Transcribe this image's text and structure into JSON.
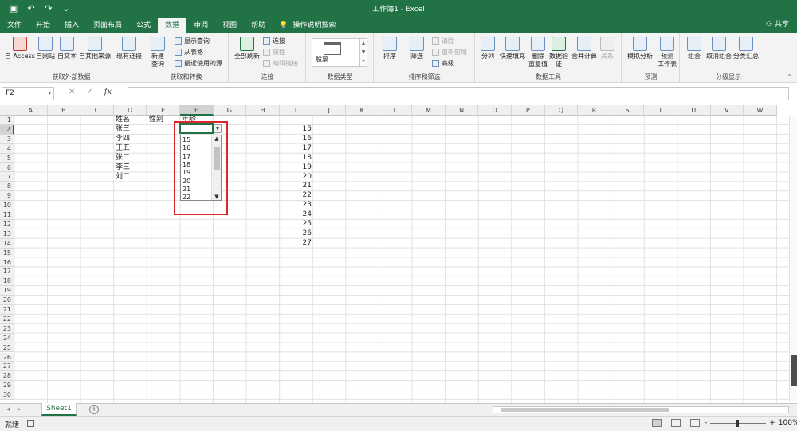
{
  "titlebar": {
    "title": "工作簿1 - Excel",
    "save_icon": "save-icon",
    "undo_icon": "undo-icon",
    "redo_icon": "redo-icon"
  },
  "tabs": [
    "文件",
    "开始",
    "插入",
    "页面布局",
    "公式",
    "数据",
    "审阅",
    "视图",
    "帮助"
  ],
  "active_tab": "数据",
  "tell_me": "操作说明搜索",
  "share": "共享",
  "ribbon": {
    "get_external": {
      "label": "获取外部数据",
      "buttons": [
        "自 Access",
        "自网站",
        "自文本",
        "自其他来源"
      ],
      "existing": "现有连接"
    },
    "get_transform": {
      "label": "获取和转换",
      "new_query": "新建\n查询",
      "items": [
        "显示查询",
        "从表格",
        "最近使用的源"
      ]
    },
    "connections": {
      "label": "连接",
      "refresh_all": "全部刷新",
      "items": [
        "连接",
        "属性",
        "编辑链接"
      ]
    },
    "data_types": {
      "label": "数据类型",
      "stock": "股票"
    },
    "sort_filter": {
      "label": "排序和筛选",
      "sort": "排序",
      "filter": "筛选",
      "items": [
        "清除",
        "重新应用",
        "高级"
      ]
    },
    "data_tools": {
      "label": "数据工具",
      "buttons": [
        "分列",
        "快速填充",
        "删除\n重复值",
        "数据验\n证",
        "合并计算",
        "关系"
      ]
    },
    "forecast": {
      "label": "预测",
      "buttons": [
        "模拟分析",
        "预测\n工作表"
      ]
    },
    "outline": {
      "label": "分级显示",
      "buttons": [
        "组合",
        "取消组合",
        "分类汇总"
      ]
    }
  },
  "formula_bar": {
    "name_box": "F2",
    "fx": "fx",
    "cancel": "✕",
    "enter": "✓",
    "content": ""
  },
  "columns": [
    "A",
    "B",
    "C",
    "D",
    "E",
    "F",
    "G",
    "H",
    "I",
    "J",
    "K",
    "L",
    "M",
    "N",
    "O",
    "P",
    "Q",
    "R",
    "S",
    "T",
    "U",
    "V",
    "W"
  ],
  "rows": [
    "1",
    "2",
    "3",
    "4",
    "5",
    "6",
    "7",
    "8",
    "9",
    "10",
    "11",
    "12",
    "13",
    "14",
    "15",
    "16",
    "17",
    "18",
    "19",
    "20",
    "21",
    "22",
    "23",
    "24",
    "25",
    "26",
    "27",
    "28",
    "29",
    "30"
  ],
  "cells": {
    "D1": "姓名",
    "E1": "性别",
    "F1": "年龄",
    "D2": "张三",
    "D3": "李四",
    "D4": "王五",
    "D5": "张二",
    "D6": "李三",
    "D7": "刘二"
  },
  "column_i_values": [
    "15",
    "16",
    "17",
    "18",
    "19",
    "20",
    "21",
    "22",
    "23",
    "24",
    "25",
    "26",
    "27"
  ],
  "dropdown_options": [
    "15",
    "16",
    "17",
    "18",
    "19",
    "20",
    "21",
    "22"
  ],
  "sheet": {
    "tab": "Sheet1",
    "add": "+"
  },
  "status": {
    "ready": "就绪",
    "zoom": "100%",
    "minus": "-",
    "plus": "+"
  },
  "colors": {
    "brand": "#217346",
    "highlight": "#e0242b"
  }
}
